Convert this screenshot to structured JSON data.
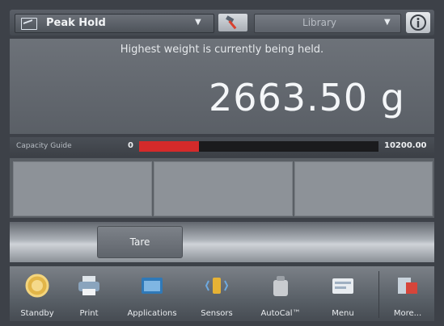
{
  "topbar": {
    "mode_label": "Peak Hold",
    "library_label": "Library",
    "icons": {
      "mode": "chart-icon",
      "tool": "hammer-icon",
      "info": "info-icon"
    }
  },
  "display": {
    "message": "Highest weight is currently being held.",
    "weight": "2663.50 g"
  },
  "capacity": {
    "label": "Capacity Guide",
    "min": "0",
    "max": "10200.00",
    "fill_fraction": 0.25,
    "fill_color": "#d42a2a"
  },
  "tare": {
    "label": "Tare"
  },
  "functions": [
    {
      "label": "Standby",
      "icon": "standby-icon"
    },
    {
      "label": "Print",
      "icon": "printer-icon"
    },
    {
      "label": "Applications",
      "icon": "applications-icon"
    },
    {
      "label": "Sensors",
      "icon": "sensors-icon"
    },
    {
      "label": "AutoCal™",
      "icon": "weight-icon"
    },
    {
      "label": "Menu",
      "icon": "menu-icon"
    },
    {
      "label": "More...",
      "icon": "more-icon"
    }
  ]
}
